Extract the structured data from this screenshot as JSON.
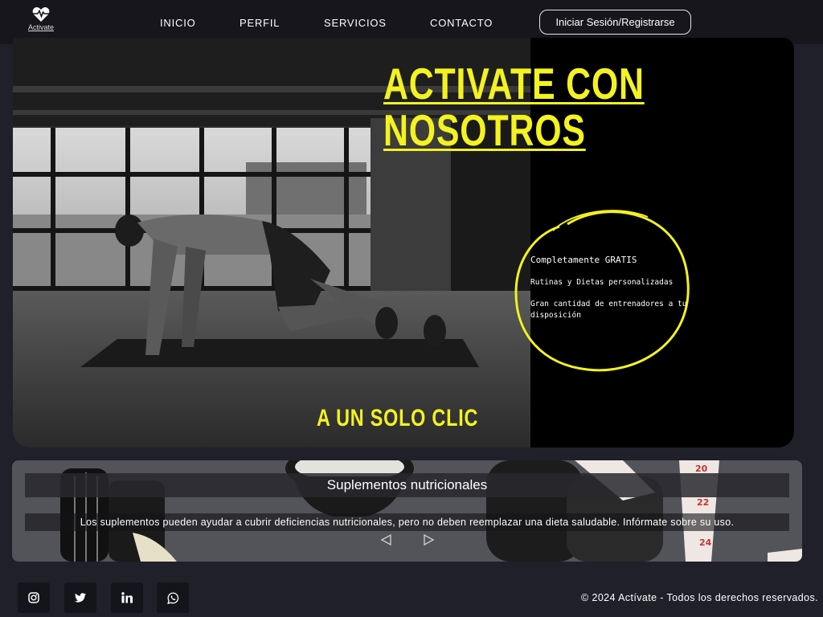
{
  "header": {
    "logo_text": "Activate",
    "nav": [
      {
        "label": "INICIO"
      },
      {
        "label": "PERFIL"
      },
      {
        "label": "SERVICIOS"
      },
      {
        "label": "CONTACTO"
      }
    ],
    "login_label": "Iniciar Sesión/Registrarse"
  },
  "hero": {
    "title_line1": "ACTIVATE CON",
    "title_line2": "NOSOTROS",
    "subtitle": "A UN SOLO CLIC",
    "features": [
      "Completamente GRATIS",
      "Rutinas y Dietas personalizadas",
      "Gran cantidad de entrenadores a tu disposición"
    ],
    "accent_color": "#f4f21f"
  },
  "supplements": {
    "title": "Suplementos nutricionales",
    "description": "Los suplementos pueden ayudar a cubrir deficiencias nutricionales, pero no deben reemplazar una dieta saludable. Infórmate sobre su uso."
  },
  "footer": {
    "social": [
      "instagram-icon",
      "twitter-icon",
      "linkedin-icon",
      "whatsapp-icon"
    ],
    "copyright": "© 2024 Actívate - Todos los derechos reservados."
  }
}
